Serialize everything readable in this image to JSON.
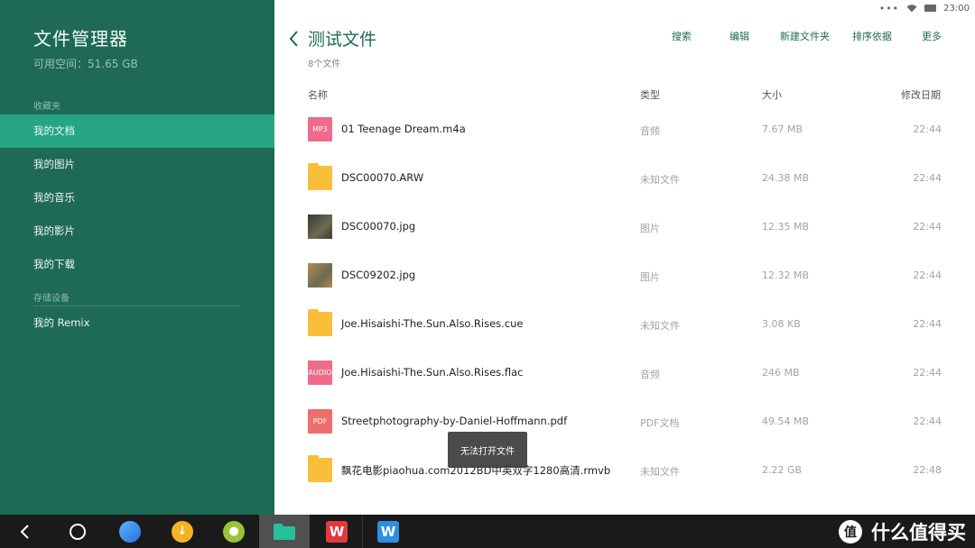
{
  "status": {
    "time": "23:00",
    "dots": "•••"
  },
  "sidebar": {
    "title": "文件管理器",
    "free_space": "可用空间：51.65 GB",
    "favorites_header": "收藏夹",
    "storage_header": "存储设备",
    "items": [
      {
        "label": "我的文档"
      },
      {
        "label": "我的图片"
      },
      {
        "label": "我的音乐"
      },
      {
        "label": "我的影片"
      },
      {
        "label": "我的下载"
      }
    ],
    "storage_item": "我的 Remix"
  },
  "header": {
    "title": "测试文件",
    "count": "8个文件",
    "actions": {
      "search": "搜索",
      "edit": "编辑",
      "new_folder": "新建文件夹",
      "sort": "排序依据",
      "more": "更多"
    }
  },
  "columns": {
    "name": "名称",
    "type": "类型",
    "size": "大小",
    "modified": "修改日期"
  },
  "files": [
    {
      "name": "01 Teenage Dream.m4a",
      "type": "音频",
      "size": "7.67 MB",
      "date": "22:44",
      "icon": "audio-file-icon",
      "badge": "MP3",
      "color": "#ef6b89"
    },
    {
      "name": "DSC00070.ARW",
      "type": "未知文件",
      "size": "24.38 MB",
      "date": "22:44",
      "icon": "folder-icon",
      "badge": "",
      "color": "#f9bf3b"
    },
    {
      "name": "DSC00070.jpg",
      "type": "图片",
      "size": "12.35 MB",
      "date": "22:44",
      "icon": "image-thumbnail-icon",
      "badge": "",
      "color": "#3a3a32"
    },
    {
      "name": "DSC09202.jpg",
      "type": "图片",
      "size": "12.32 MB",
      "date": "22:44",
      "icon": "image-thumbnail-icon",
      "badge": "",
      "color": "#b08a55"
    },
    {
      "name": "Joe.Hisaishi-The.Sun.Also.Rises.cue",
      "type": "未知文件",
      "size": "3.08 KB",
      "date": "22:44",
      "icon": "folder-icon",
      "badge": "",
      "color": "#f9bf3b"
    },
    {
      "name": "Joe.Hisaishi-The.Sun.Also.Rises.flac",
      "type": "音频",
      "size": "246 MB",
      "date": "22:44",
      "icon": "audio-file-icon",
      "badge": "AUDIO",
      "color": "#ef6b89"
    },
    {
      "name": "Streetphotography-by-Daniel-Hoffmann.pdf",
      "type": "PDF文档",
      "size": "49.54 MB",
      "date": "22:44",
      "icon": "pdf-file-icon",
      "badge": "PDF",
      "color": "#f06d6d"
    },
    {
      "name": "飘花电影piaohua.com2012BD中英双字1280高清.rmvb",
      "type": "未知文件",
      "size": "2.22 GB",
      "date": "22:48",
      "icon": "folder-icon",
      "badge": "",
      "color": "#f9bf3b"
    }
  ],
  "toast": "无法打开文件",
  "watermark": "什么值得买",
  "colors": {
    "sidebar": "#1f6a55",
    "accent": "#26a585",
    "folder": "#f9bf3b"
  }
}
